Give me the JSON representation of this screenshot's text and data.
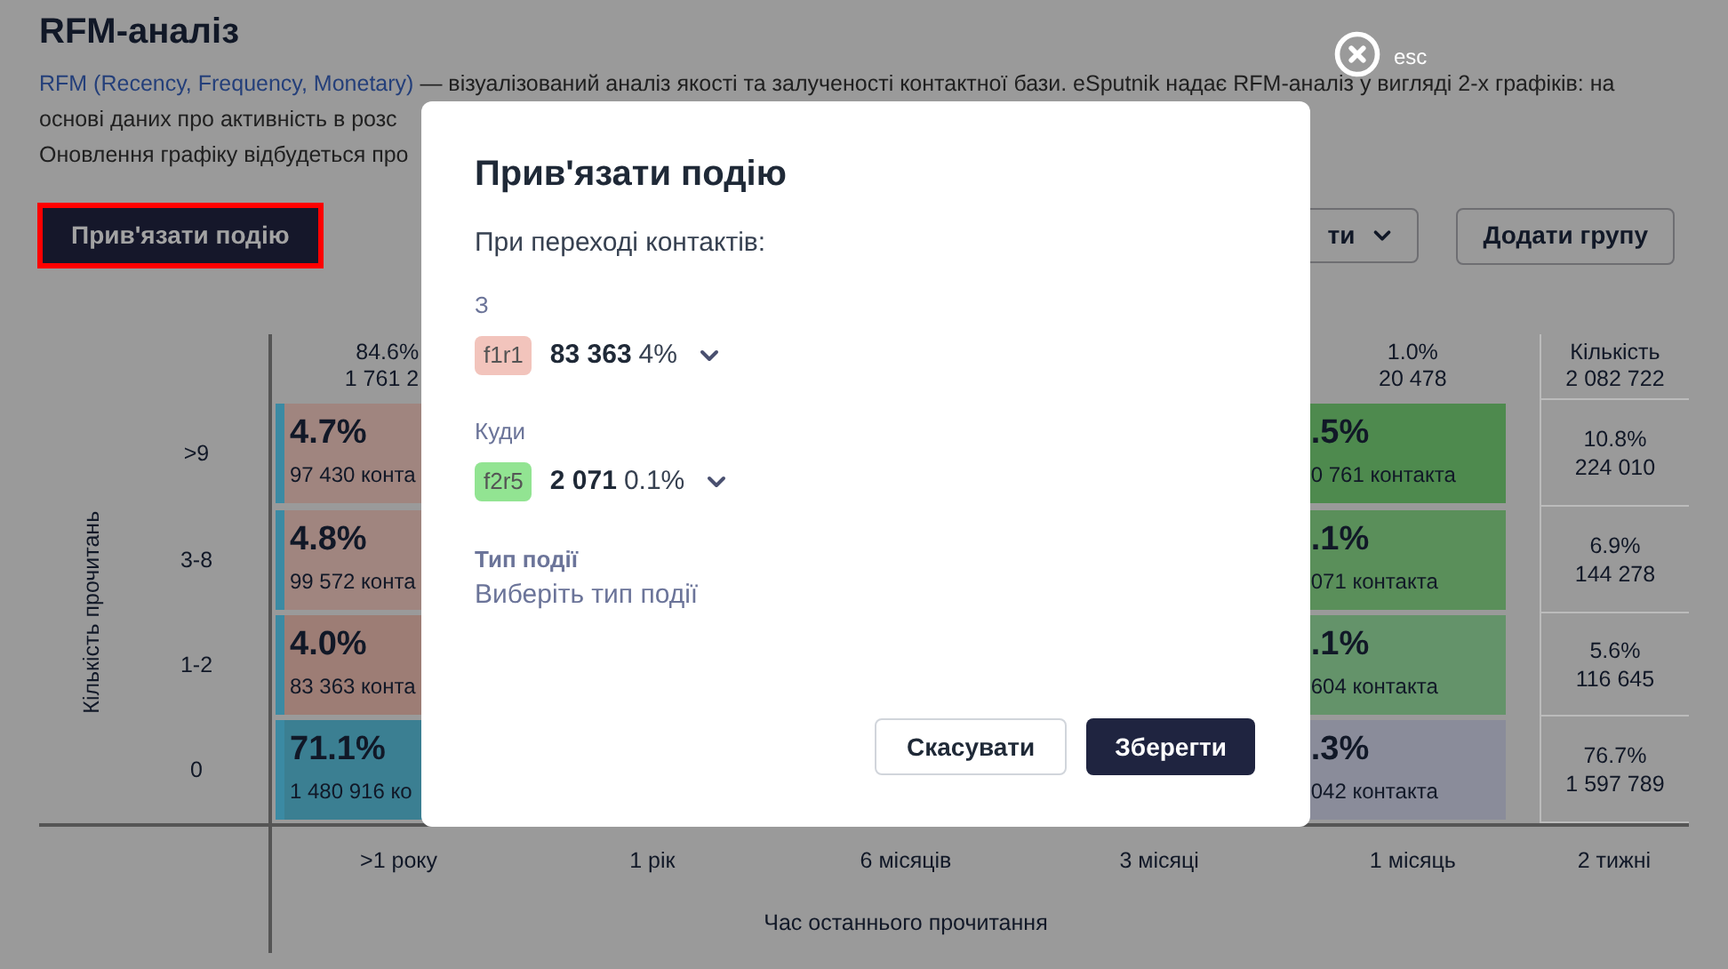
{
  "page": {
    "title": "RFM-аналіз",
    "intro": {
      "link": "RFM (Recency, Frequency, Monetary)",
      "text": "— візуалізований аналіз якості та залученості контактної бази. eSputnik надає RFM-аналіз у вигляді 2-х графіків: на"
    },
    "intro_lines": [
      "основі даних про активність в розс",
      "Оновлення графіку відбудеться про"
    ]
  },
  "toolbar": {
    "bind_button": {
      "label": "Прив'язати подію",
      "highlighted": true
    },
    "menu_button": {
      "label": "ти"
    },
    "add_group_button": {
      "label": "Додати групу"
    }
  },
  "matrix": {
    "y_label": "Кількість прочитань",
    "x_label": "Час останнього прочитання",
    "header": [
      {
        "share": "84.6%",
        "total": "1 761 2"
      },
      {
        "share": "1.0%",
        "total": "20 478"
      }
    ],
    "summary": {
      "title": "Кількість",
      "total": "2 082 722"
    },
    "rows": [
      {
        "label": ">9",
        "cells": [
          {
            "share": "4.7%",
            "contacts": "97 430 конта",
            "color": "#a0857f"
          },
          {
            "share": ".5%",
            "contacts": "0 761 контакта",
            "color": "#4e8a4e"
          }
        ],
        "summary_share": "10.8%",
        "summary_total": "224 010"
      },
      {
        "label": "3-8",
        "cells": [
          {
            "share": "4.8%",
            "contacts": "99 572 конта",
            "color": "#a0857f"
          },
          {
            "share": ".1%",
            "contacts": "071 контакта",
            "color": "#5a8f5a"
          }
        ],
        "summary_share": "6.9%",
        "summary_total": "144 278"
      },
      {
        "label": "1-2",
        "cells": [
          {
            "share": "4.0%",
            "contacts": "83 363 конта",
            "color": "#9d7d75"
          },
          {
            "share": ".1%",
            "contacts": "604 контакта",
            "color": "#64936a"
          }
        ],
        "summary_share": "5.6%",
        "summary_total": "116 645"
      },
      {
        "label": "0",
        "cells": [
          {
            "share": "71.1%",
            "contacts": "1 480 916 ко",
            "color": "#3b7f92"
          },
          {
            "share": ".3%",
            "contacts": "042 контакта",
            "color": "#8a8c9a"
          }
        ],
        "summary_share": "76.7%",
        "summary_total": "1 597 789"
      }
    ],
    "x_ticks": [
      ">1 року",
      "1 рік",
      "6 місяців",
      "3 місяці",
      "1 місяць",
      "2 тижні"
    ]
  },
  "modal": {
    "title": "Прив'язати подію",
    "subtitle": "При переході контактів:",
    "from": {
      "label": "З",
      "tag": "f1r1",
      "color": "#f2c4bc",
      "count": "83 363",
      "share": "4%"
    },
    "to": {
      "label": "Куди",
      "tag": "f2r5",
      "color": "#92e492",
      "count": "2 071",
      "share": "0.1%"
    },
    "event_type": {
      "label": "Тип події",
      "placeholder": "Виберіть тип події"
    },
    "buttons": [
      {
        "label": "Скасувати",
        "kind": "secondary"
      },
      {
        "label": "Зберегти",
        "kind": "primary"
      }
    ],
    "close": {
      "label": "esc"
    }
  }
}
